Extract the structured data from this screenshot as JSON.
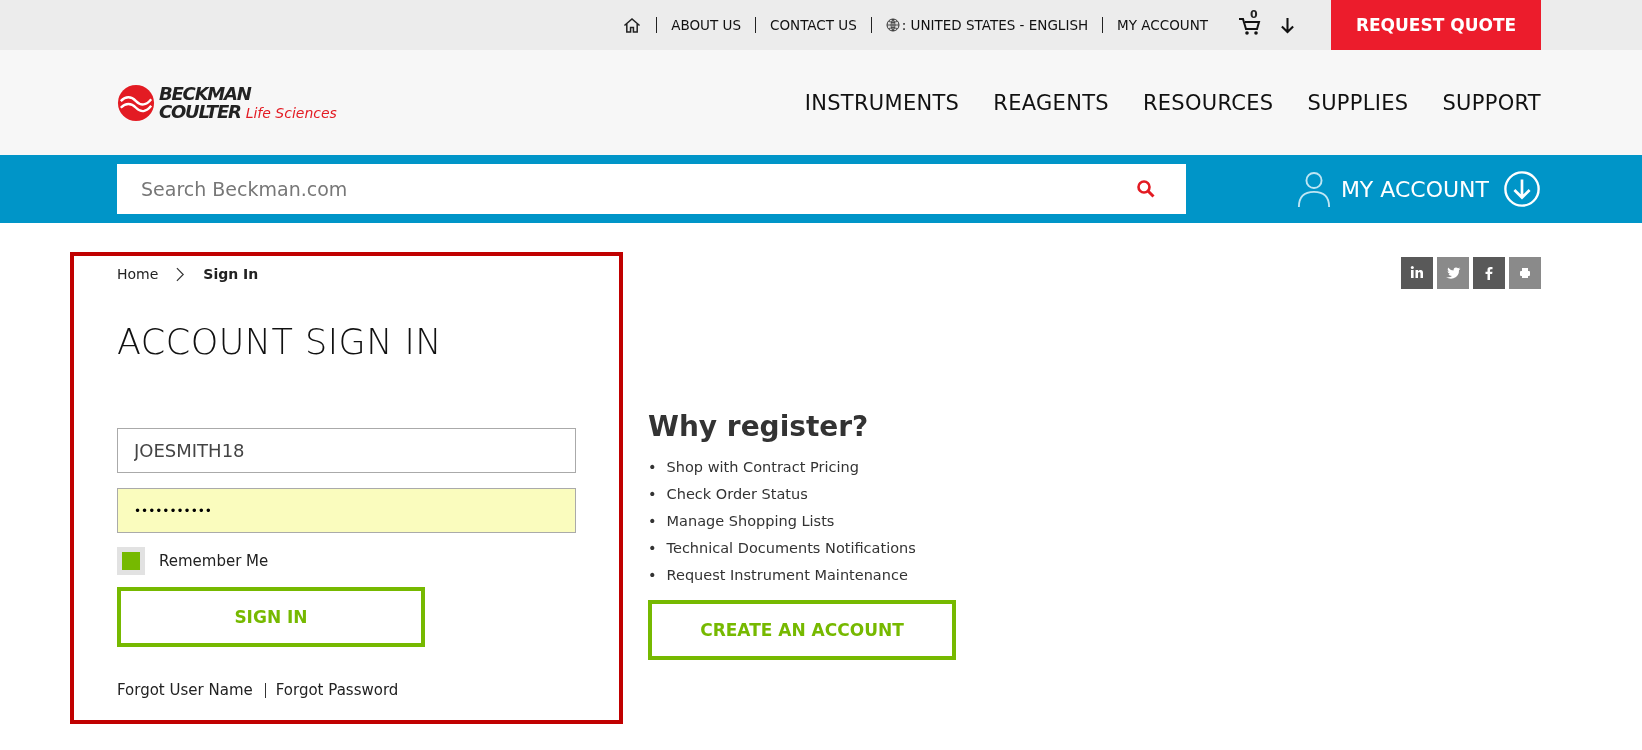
{
  "utility_bar": {
    "links": [
      "ABOUT US",
      "CONTACT US",
      ": UNITED STATES - ENGLISH",
      "MY ACCOUNT"
    ],
    "cart_count": "0",
    "request_quote": "REQUEST QUOTE"
  },
  "logo": {
    "line1": "BECKMAN",
    "line2": "COULTER",
    "tagline": "Life Sciences"
  },
  "nav": [
    "INSTRUMENTS",
    "REAGENTS",
    "RESOURCES",
    "SUPPLIES",
    "SUPPORT"
  ],
  "search": {
    "placeholder": "Search Beckman.com"
  },
  "account_menu": {
    "label": "MY ACCOUNT"
  },
  "breadcrumb": [
    "Home",
    "Sign In"
  ],
  "sign_in": {
    "title": "ACCOUNT SIGN IN",
    "username": "JOESMITH18",
    "password": "•••••••••••",
    "remember_me": {
      "label": "Remember Me",
      "checked": true
    },
    "button": "SIGN IN",
    "links": [
      "Forgot User Name",
      "Forgot Password"
    ]
  },
  "why_register": {
    "title": "Why register?",
    "bullet": "•",
    "items": [
      "Shop with Contract Pricing",
      "Check Order Status",
      "Manage Shopping Lists",
      "Technical Documents Notifications",
      "Request Instrument Maintenance"
    ],
    "button": "CREATE AN ACCOUNT"
  }
}
